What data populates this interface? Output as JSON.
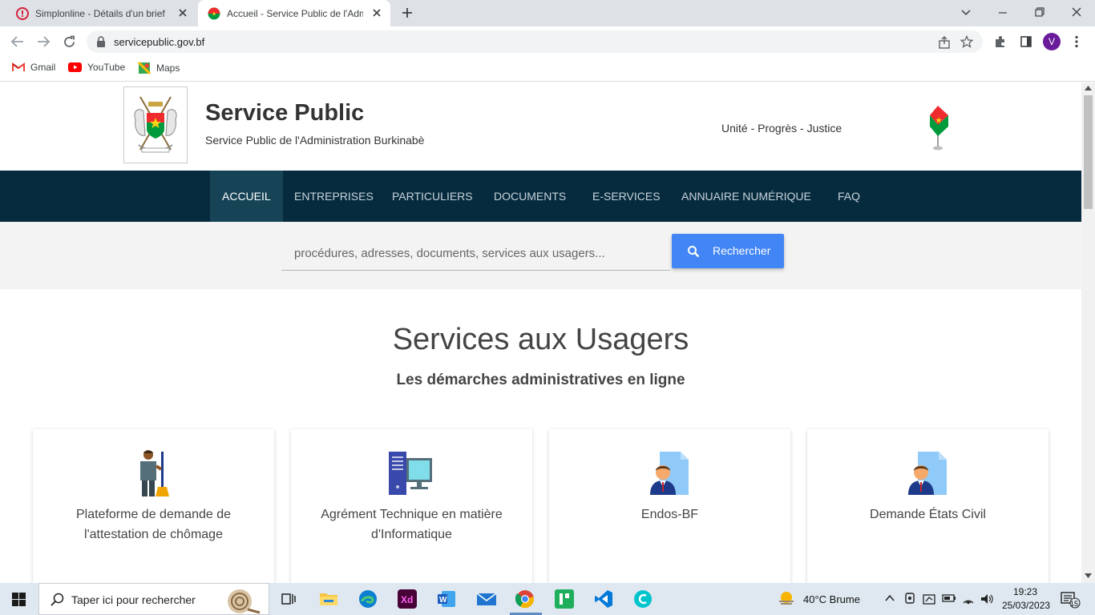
{
  "browser": {
    "tabs": [
      {
        "title": "Simplonline - Détails d'un brief",
        "icon": "simplon-icon"
      },
      {
        "title": "Accueil - Service Public de l'Administration Burkinabè",
        "icon": "burkina-flag-icon"
      }
    ],
    "url": "servicepublic.gov.bf",
    "profile_initial": "V",
    "bookmarks": [
      "Gmail",
      "YouTube",
      "Maps"
    ]
  },
  "site": {
    "title": "Service Public",
    "subtitle": "Service Public de l'Administration Burkinabè",
    "motto": "Unité - Progrès - Justice",
    "nav": [
      "ACCUEIL",
      "ENTREPRISES",
      "PARTICULIERS",
      "DOCUMENTS",
      "E-SERVICES",
      "ANNUAIRE NUMÉRIQUE",
      "FAQ"
    ],
    "active_nav": "ACCUEIL",
    "search": {
      "placeholder": "procédures, adresses, documents, services aux usagers...",
      "button": "Rechercher"
    },
    "section_title": "Services aux Usagers",
    "section_subtitle": "Les démarches administratives en ligne",
    "cards": [
      {
        "label": "Plateforme de demande de l'attestation de chômage",
        "icon": "cleaner-worker-icon"
      },
      {
        "label": "Agrément Technique en matière d'Informatique",
        "icon": "computer-icon"
      },
      {
        "label": "Endos-BF",
        "icon": "user-document-icon"
      },
      {
        "label": "Demande États Civil",
        "icon": "user-document-icon"
      }
    ]
  },
  "taskbar": {
    "search_placeholder": "Taper ici pour rechercher",
    "weather": "40°C  Brume",
    "time": "19:23",
    "date": "25/03/2023",
    "notifications": "15"
  },
  "colors": {
    "nav_bg": "#062b3e",
    "nav_active": "#174357",
    "search_button": "#4285f4"
  }
}
